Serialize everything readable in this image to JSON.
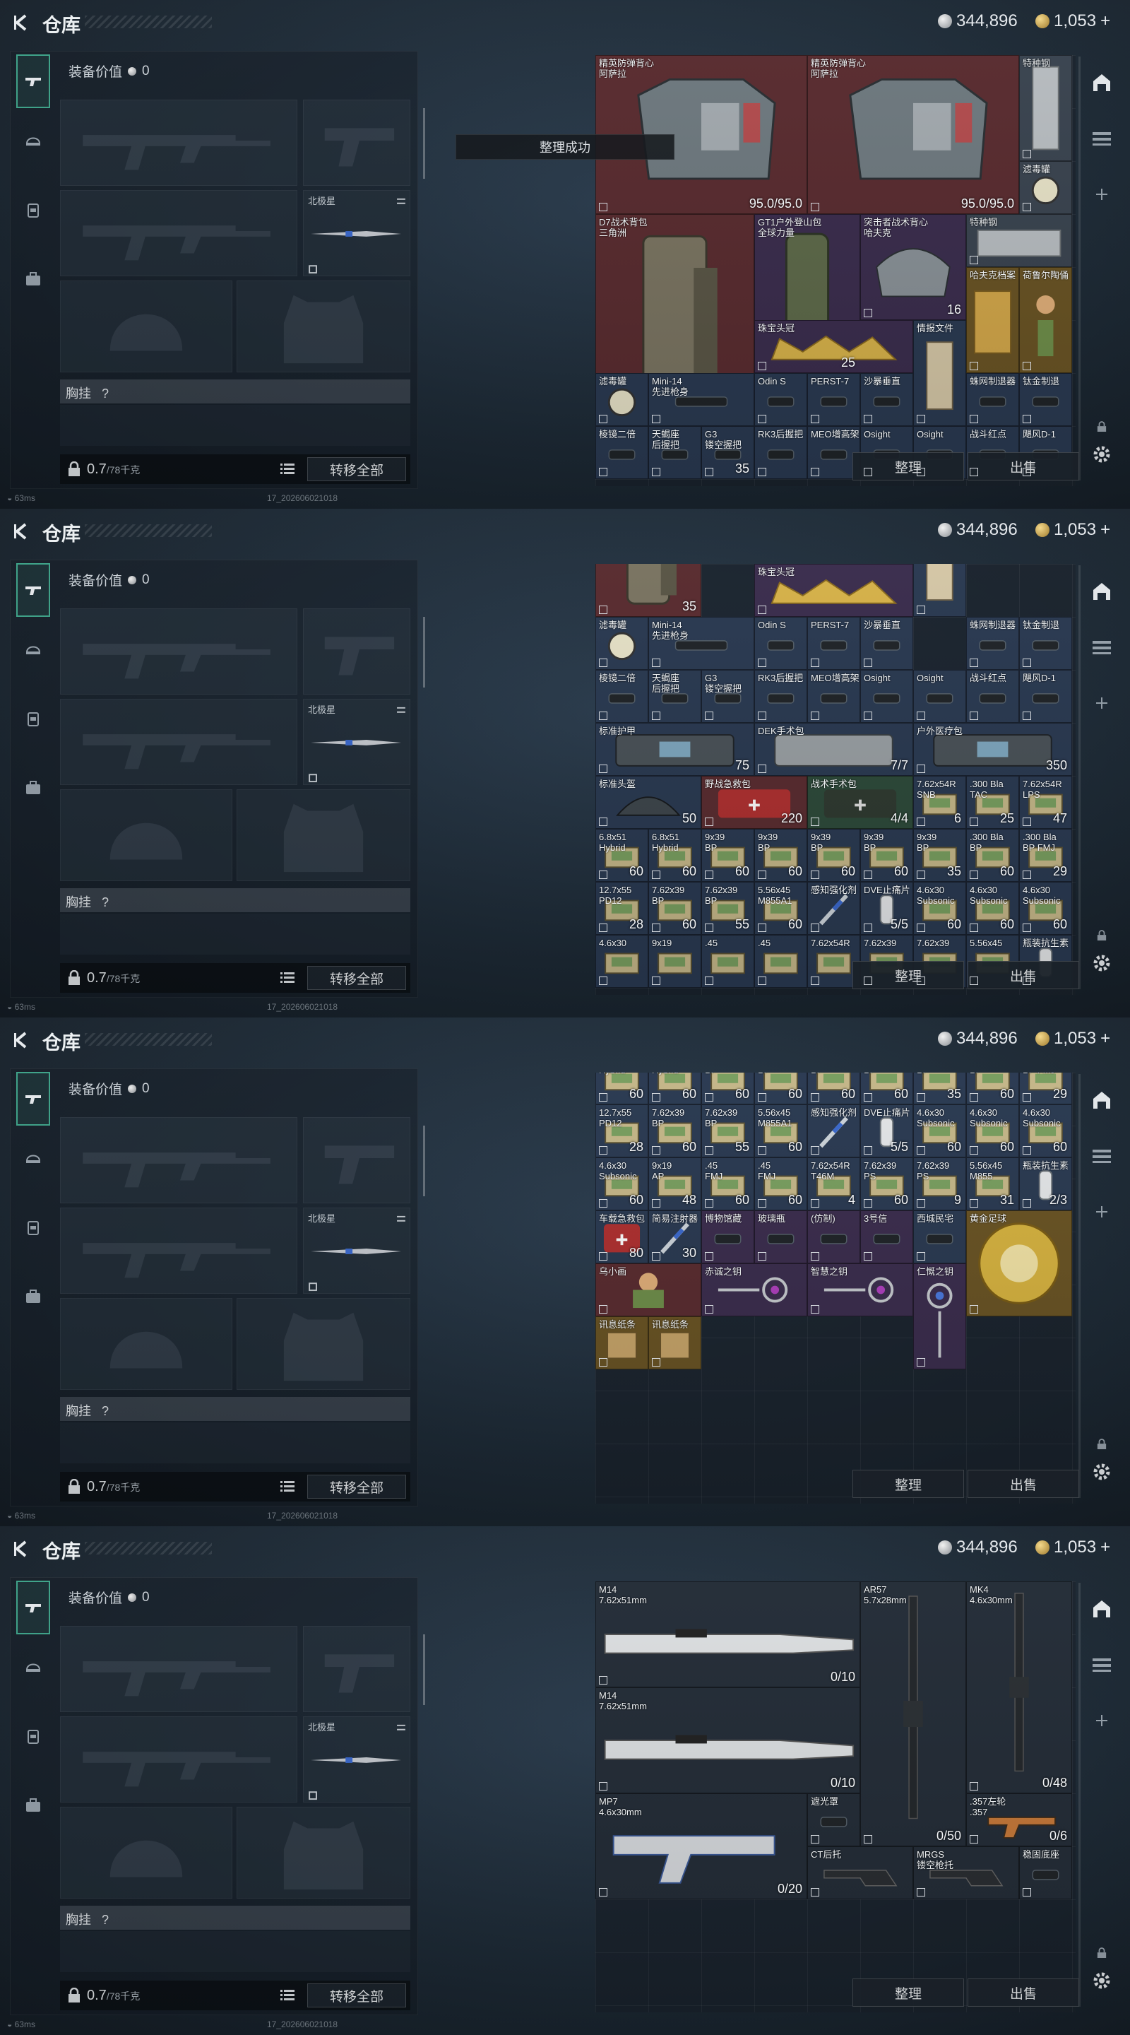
{
  "screens": [
    {
      "id": 1,
      "variant": "stash-top"
    },
    {
      "id": 2,
      "variant": "stash-scroll-1"
    },
    {
      "id": 3,
      "variant": "stash-scroll-2"
    },
    {
      "id": 4,
      "variant": "weapon-tab"
    }
  ],
  "header": {
    "title": "仓库",
    "silver": "344,896",
    "gold": "1,053",
    "gold_plus": "+"
  },
  "loadout": {
    "equip_value_label": "装备价值",
    "equip_value": "0",
    "slot_melee_label": "北极星",
    "chest_label": "胸挂",
    "chest_help": "?",
    "weight_value": "0.7",
    "weight_max": "/78千克",
    "transfer_all": "转移全部"
  },
  "stash": {
    "sort_label": "整理",
    "sell_label": "出售"
  },
  "toast": "整理成功",
  "status": {
    "ping": "63ms",
    "build": "17_202606021018"
  },
  "screen1": {
    "items": [
      {
        "name": "精英防弹背心\n阿萨拉",
        "qty": "95.0/95.0"
      },
      {
        "name": "精英防弹背心\n阿萨拉",
        "qty": "95.0/95.0"
      },
      {
        "name": "特种钢",
        "qty": ""
      },
      {
        "name": "滤毒罐",
        "qty": ""
      },
      {
        "name": "D7战术背包\n三角洲",
        "qty": "35"
      },
      {
        "name": "GT1户外登山包\n全球力量",
        "qty": "25"
      },
      {
        "name": "突击者战术背心\n哈夫克",
        "qty": "16"
      },
      {
        "name": "特种钢",
        "qty": ""
      },
      {
        "name": "哈夫克档案",
        "qty": ""
      },
      {
        "name": "荷鲁尔陶俑",
        "qty": ""
      },
      {
        "name": "珠宝头冠",
        "qty": ""
      },
      {
        "name": "情报文件",
        "qty": ""
      },
      {
        "name": "滤毒罐",
        "qty": ""
      },
      {
        "name": "Mini-14\n先进枪身",
        "qty": ""
      },
      {
        "name": "Odin S",
        "qty": ""
      },
      {
        "name": "PERST-7",
        "qty": ""
      },
      {
        "name": "沙暴垂直",
        "qty": ""
      },
      {
        "name": "蛛网制退器",
        "qty": ""
      },
      {
        "name": "钛金制退",
        "qty": ""
      },
      {
        "name": "棱镜二倍",
        "qty": ""
      },
      {
        "name": "天蝎座\n后握把",
        "qty": ""
      },
      {
        "name": "G3\n镂空握把",
        "qty": ""
      },
      {
        "name": "RK3后握把",
        "qty": ""
      },
      {
        "name": "MEO增高架",
        "qty": ""
      },
      {
        "name": "Osight",
        "qty": ""
      },
      {
        "name": "Osight",
        "qty": ""
      },
      {
        "name": "战斗红点",
        "qty": ""
      },
      {
        "name": "飓风D-1",
        "qty": ""
      }
    ]
  },
  "screen2": {
    "items": [
      {
        "name": "",
        "qty": "35"
      },
      {
        "name": "珠宝头冠",
        "qty": ""
      },
      {
        "name": "情报文件",
        "qty": ""
      },
      {
        "name": "滤毒罐",
        "qty": ""
      },
      {
        "name": "Mini-14\n先进枪身",
        "qty": ""
      },
      {
        "name": "Odin S",
        "qty": ""
      },
      {
        "name": "PERST-7",
        "qty": ""
      },
      {
        "name": "沙暴垂直",
        "qty": ""
      },
      {
        "name": "蛛网制退器",
        "qty": ""
      },
      {
        "name": "钛金制退",
        "qty": ""
      },
      {
        "name": "棱镜二倍",
        "qty": ""
      },
      {
        "name": "天蝎座\n后握把",
        "qty": ""
      },
      {
        "name": "G3\n镂空握把",
        "qty": ""
      },
      {
        "name": "RK3后握把",
        "qty": ""
      },
      {
        "name": "MEO增高架",
        "qty": ""
      },
      {
        "name": "Osight",
        "qty": ""
      },
      {
        "name": "Osight",
        "qty": ""
      },
      {
        "name": "战斗红点",
        "qty": ""
      },
      {
        "name": "飓风D-1",
        "qty": ""
      },
      {
        "name": "标准护甲",
        "qty": "75"
      },
      {
        "name": "DEK手术包",
        "qty": "7/7"
      },
      {
        "name": "户外医疗包",
        "qty": "350"
      },
      {
        "name": "标准头盔",
        "qty": "50"
      },
      {
        "name": "野战急救包",
        "qty": "220"
      },
      {
        "name": "战术手术包",
        "qty": "4/4"
      },
      {
        "name": "7.62x54R\nSNB",
        "qty": "6"
      },
      {
        "name": ".300 Bla\nTAC",
        "qty": "25"
      },
      {
        "name": "7.62x54R\nLPS",
        "qty": "47"
      },
      {
        "name": "6.8x51\nHybrid",
        "qty": "60"
      },
      {
        "name": "6.8x51\nHybrid",
        "qty": "60"
      },
      {
        "name": "9x39\nBP",
        "qty": "60"
      },
      {
        "name": "9x39\nBP",
        "qty": "60"
      },
      {
        "name": "9x39\nBP",
        "qty": "60"
      },
      {
        "name": "9x39\nBP",
        "qty": "60"
      },
      {
        "name": "9x39\nBP",
        "qty": "35"
      },
      {
        "name": ".300 Bla\nBP",
        "qty": "60"
      },
      {
        "name": ".300 Bla\nBP FMJ",
        "qty": "29"
      },
      {
        "name": "12.7x55\nPD12",
        "qty": "28"
      },
      {
        "name": "7.62x39\nBP",
        "qty": "60"
      },
      {
        "name": "7.62x39\nBP",
        "qty": "55"
      },
      {
        "name": "5.56x45\nM855A1",
        "qty": "60"
      },
      {
        "name": "感知强化剂",
        "qty": ""
      },
      {
        "name": "DVE止痛片",
        "qty": "5/5"
      },
      {
        "name": "4.6x30\nSubsonic",
        "qty": "60"
      },
      {
        "name": "4.6x30\nSubsonic",
        "qty": "60"
      },
      {
        "name": "4.6x30\nSubsonic",
        "qty": "60"
      },
      {
        "name": "4.6x30",
        "qty": ""
      },
      {
        "name": "9x19",
        "qty": ""
      },
      {
        "name": ".45",
        "qty": ""
      },
      {
        "name": ".45",
        "qty": ""
      },
      {
        "name": "7.62x54R",
        "qty": ""
      },
      {
        "name": "7.62x39",
        "qty": ""
      },
      {
        "name": "7.62x39",
        "qty": ""
      },
      {
        "name": "5.56x45",
        "qty": ""
      },
      {
        "name": "瓶装抗生素",
        "qty": ""
      }
    ]
  },
  "screen3": {
    "items": [
      {
        "name": "6.8x51\nHybrid",
        "qty": "60"
      },
      {
        "name": "6.8x51\nHybrid",
        "qty": "60"
      },
      {
        "name": "9x39\nBP",
        "qty": "60"
      },
      {
        "name": "9x39\nBP",
        "qty": "60"
      },
      {
        "name": "9x39\nBP",
        "qty": "60"
      },
      {
        "name": "9x39\nBP",
        "qty": "60"
      },
      {
        "name": "9x39\nBP",
        "qty": "35"
      },
      {
        "name": ".300 Bla\nBP",
        "qty": "60"
      },
      {
        "name": ".300 Bla\nBP FMJ",
        "qty": "29"
      },
      {
        "name": "12.7x55\nPD12",
        "qty": "28"
      },
      {
        "name": "7.62x39\nBP",
        "qty": "60"
      },
      {
        "name": "7.62x39\nBP",
        "qty": "55"
      },
      {
        "name": "5.56x45\nM855A1",
        "qty": "60"
      },
      {
        "name": "感知强化剂",
        "qty": ""
      },
      {
        "name": "DVE止痛片",
        "qty": "5/5"
      },
      {
        "name": "4.6x30\nSubsonic",
        "qty": "60"
      },
      {
        "name": "4.6x30\nSubsonic",
        "qty": "60"
      },
      {
        "name": "4.6x30\nSubsonic",
        "qty": "60"
      },
      {
        "name": "4.6x30\nSubsonic",
        "qty": "60"
      },
      {
        "name": "9x19\nAP",
        "qty": "48"
      },
      {
        "name": ".45\nFMJ",
        "qty": "60"
      },
      {
        "name": ".45\nFMJ",
        "qty": "60"
      },
      {
        "name": "7.62x54R\nT46M",
        "qty": "4"
      },
      {
        "name": "7.62x39\nPS",
        "qty": "60"
      },
      {
        "name": "7.62x39\nPS",
        "qty": "9"
      },
      {
        "name": "5.56x45\nM855",
        "qty": "31"
      },
      {
        "name": "瓶装抗生素",
        "qty": "2/3"
      },
      {
        "name": "车载急救包",
        "qty": "80"
      },
      {
        "name": "简易注射器",
        "qty": "30"
      },
      {
        "name": "博物馆藏",
        "qty": ""
      },
      {
        "name": "玻璃瓶",
        "qty": ""
      },
      {
        "name": "(仿制)",
        "qty": ""
      },
      {
        "name": "3号信",
        "qty": ""
      },
      {
        "name": "西城民宅",
        "qty": ""
      },
      {
        "name": "黄金足球",
        "qty": ""
      },
      {
        "name": "乌小画",
        "qty": ""
      },
      {
        "name": "赤诚之钥",
        "qty": ""
      },
      {
        "name": "智慧之钥",
        "qty": ""
      },
      {
        "name": "仁慨之钥",
        "qty": ""
      },
      {
        "name": "讯息纸条",
        "qty": ""
      },
      {
        "name": "讯息纸条",
        "qty": ""
      }
    ]
  },
  "screen4": {
    "items": [
      {
        "name": "M14\n7.62x51mm",
        "qty": "0/10"
      },
      {
        "name": "AR57\n5.7x28mm",
        "qty": "0/50"
      },
      {
        "name": "MK4\n4.6x30mm",
        "qty": "0/48"
      },
      {
        "name": "M14\n7.62x51mm",
        "qty": "0/10"
      },
      {
        "name": "MP7\n4.6x30mm",
        "qty": "0/20"
      },
      {
        "name": "遮光罩",
        "qty": ""
      },
      {
        "name": ".357左轮\n.357",
        "qty": "0/6"
      },
      {
        "name": "CT后托",
        "qty": ""
      },
      {
        "name": "MRGS\n镂空枪托",
        "qty": ""
      },
      {
        "name": "稳固底座",
        "qty": ""
      }
    ]
  }
}
